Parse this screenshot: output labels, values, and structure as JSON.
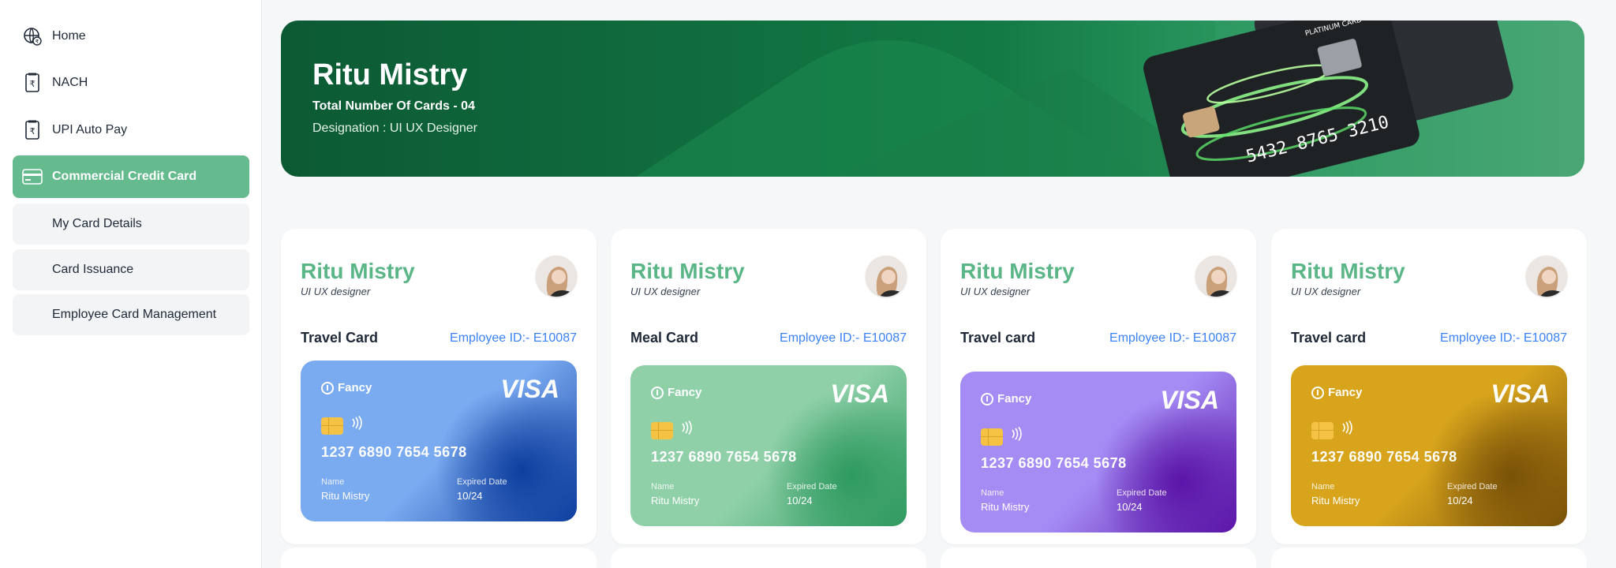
{
  "sidebar": {
    "items": [
      {
        "label": "Home",
        "icon": "globe-rupee-icon"
      },
      {
        "label": "NACH",
        "icon": "rupee-document-icon"
      },
      {
        "label": "UPI Auto Pay",
        "icon": "rupee-document-icon"
      },
      {
        "label": "Commercial Credit Card",
        "icon": "credit-card-icon",
        "active": true
      }
    ],
    "subitems": [
      {
        "label": "My Card Details"
      },
      {
        "label": "Card Issuance"
      },
      {
        "label": "Employee Card Management"
      }
    ]
  },
  "banner": {
    "name": "Ritu Mistry",
    "count": "Total Number Of Cards - 04",
    "designation": "Designation : UI UX Designer",
    "card_art": {
      "label": "PLATINUM CARD",
      "number": "5432 8765 3210"
    }
  },
  "cards": [
    {
      "name": "Ritu Mistry",
      "role": "UI UX designer",
      "type": "Travel Card",
      "employee_id": "Employee ID:- E10087",
      "brand": "Fancy",
      "network": "VISA",
      "number": "1237 6890 7654 5678",
      "name_label": "Name",
      "holder": "Ritu Mistry",
      "exp_label": "Expired Date",
      "expiry": "10/24",
      "color": "#7aaaf0",
      "shade": "#0e3fa0"
    },
    {
      "name": "Ritu Mistry",
      "role": "UI UX designer",
      "type": "Meal Card",
      "employee_id": "Employee ID:- E10087",
      "brand": "Fancy",
      "network": "VISA",
      "number": "1237 6890 7654 5678",
      "name_label": "Name",
      "holder": "Ritu Mistry",
      "exp_label": "Expired Date",
      "expiry": "10/24",
      "color": "#8fd0a9",
      "shade": "#2e9a5f"
    },
    {
      "name": "Ritu Mistry",
      "role": "UI UX designer",
      "type": "Travel card",
      "employee_id": "Employee ID:- E10087",
      "brand": "Fancy",
      "network": "VISA",
      "number": "1237 6890 7654 5678",
      "name_label": "Name",
      "holder": "Ritu Mistry",
      "exp_label": "Expired Date",
      "expiry": "10/24",
      "color": "#a58cf5",
      "shade": "#5b14a8"
    },
    {
      "name": "Ritu Mistry",
      "role": "UI UX designer",
      "type": "Travel card",
      "employee_id": "Employee ID:- E10087",
      "brand": "Fancy",
      "network": "VISA",
      "number": "1237 6890 7654 5678",
      "name_label": "Name",
      "holder": "Ritu Mistry",
      "exp_label": "Expired Date",
      "expiry": "10/24",
      "color": "#d8a41c",
      "shade": "#7a5208"
    }
  ]
}
